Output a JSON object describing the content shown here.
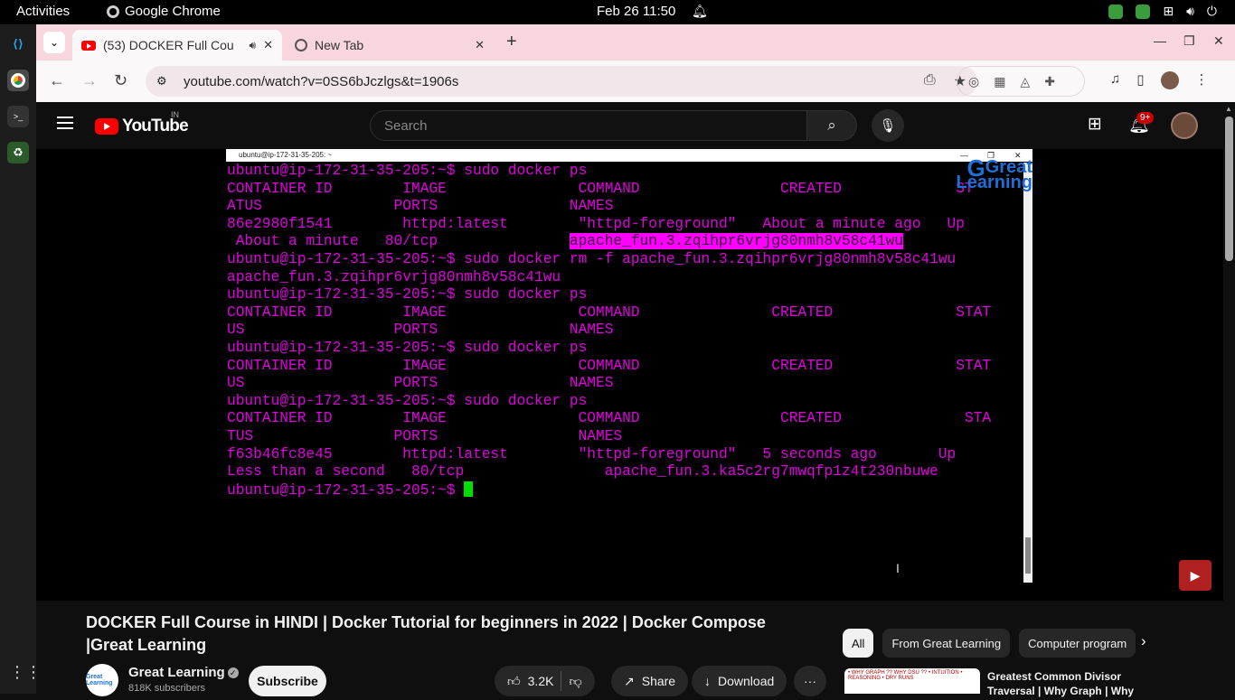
{
  "system": {
    "activities": "Activities",
    "app_name": "Google Chrome",
    "clock": "Feb 26  11:50"
  },
  "browser": {
    "tabs": [
      {
        "title": "(53) DOCKER Full Cou",
        "close": "✕"
      },
      {
        "title": "New Tab",
        "close": "✕"
      }
    ],
    "url": "youtube.com/watch?v=0SS6bJczlgs&t=1906s"
  },
  "youtube": {
    "logo_text": "YouTube",
    "country": "IN",
    "search_placeholder": "Search",
    "notification_badge": "9+",
    "video": {
      "title": "DOCKER Full Course in HINDI | Docker Tutorial for beginners in 2022 | Docker Compose |Great Learning",
      "channel": "Great Learning",
      "subscribers": "818K subscribers",
      "subscribe_label": "Subscribe",
      "likes": "3.2K",
      "share_label": "Share",
      "download_label": "Download",
      "more_label": "···"
    },
    "chips": [
      "All",
      "From Great Learning",
      "Computer program"
    ],
    "recommendation": {
      "title": "Greatest Common Divisor Traversal | Why Graph | Why",
      "thumb_text": "• WHY GRAPH ?? WHY DSU ?? • INTUITION • REASONING • DRY RUNS"
    },
    "avatar_text": "Great Learning"
  },
  "terminal": {
    "window_title": "ubuntu@ip-172-31-35-205: ~",
    "watermark": "Great Learning",
    "lines": [
      "ubuntu@ip-172-31-35-205:~$ sudo docker ps",
      "CONTAINER ID        IMAGE               COMMAND                CREATED             ST",
      "ATUS               PORTS               NAMES",
      "86e2980f1541        httpd:latest        \"httpd-foreground\"   About a minute ago   Up",
      " About a minute   80/tcp               ",
      "ubuntu@ip-172-31-35-205:~$ sudo docker rm -f apache_fun.3.zqihpr6vrjg80nmh8v58c41wu",
      "apache_fun.3.zqihpr6vrjg80nmh8v58c41wu",
      "ubuntu@ip-172-31-35-205:~$ sudo docker ps",
      "CONTAINER ID        IMAGE               COMMAND               CREATED              STAT",
      "US                 PORTS               NAMES",
      "ubuntu@ip-172-31-35-205:~$ sudo docker ps",
      "CONTAINER ID        IMAGE               COMMAND               CREATED              STAT",
      "US                 PORTS               NAMES",
      "ubuntu@ip-172-31-35-205:~$ sudo docker ps",
      "CONTAINER ID        IMAGE               COMMAND                CREATED              STA",
      "TUS                PORTS                NAMES",
      "f63b46fc8e45        httpd:latest        \"httpd-foreground\"   5 seconds ago       Up",
      "Less than a second   80/tcp                apache_fun.3.ka5c2rg7mwqfp1z4t230nbuwe",
      "ubuntu@ip-172-31-35-205:~$ "
    ],
    "highlighted": "apache_fun.3.zqihpr6vrjg80nmh8v58c41wu"
  }
}
